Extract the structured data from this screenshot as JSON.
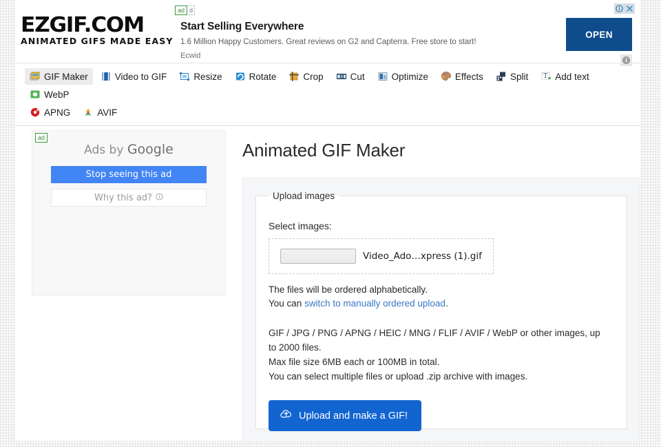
{
  "site": {
    "logo_main": "EZGIF.COM",
    "logo_sub": "ANIMATED GIFS MADE EASY"
  },
  "top_ad": {
    "badge": "ad",
    "badge_ghost": "d",
    "headline": "Start Selling Everywhere",
    "description": "1.6 Million Happy Customers. Great reviews on G2 and Capterra. Free store to start!",
    "source": "Ecwid",
    "cta_label": "OPEN",
    "info_icon": "info-icon",
    "close_icon": "close-icon",
    "corner_info_icon": "info-icon"
  },
  "nav": {
    "items": [
      {
        "label": "GIF Maker",
        "icon": "gif-maker-icon",
        "active": true
      },
      {
        "label": "Video to GIF",
        "icon": "video-icon",
        "active": false
      },
      {
        "label": "Resize",
        "icon": "resize-icon",
        "active": false
      },
      {
        "label": "Rotate",
        "icon": "rotate-icon",
        "active": false
      },
      {
        "label": "Crop",
        "icon": "crop-icon",
        "active": false
      },
      {
        "label": "Cut",
        "icon": "cut-icon",
        "active": false
      },
      {
        "label": "Optimize",
        "icon": "optimize-icon",
        "active": false
      },
      {
        "label": "Effects",
        "icon": "effects-icon",
        "active": false
      },
      {
        "label": "Split",
        "icon": "split-icon",
        "active": false
      },
      {
        "label": "Add text",
        "icon": "add-text-icon",
        "active": false
      },
      {
        "label": "WebP",
        "icon": "webp-icon",
        "active": false
      },
      {
        "label": "APNG",
        "icon": "apng-icon",
        "active": false
      },
      {
        "label": "AVIF",
        "icon": "avif-icon",
        "active": false
      }
    ]
  },
  "side_ad": {
    "badge": "ad",
    "title_prefix": "Ads by ",
    "title_brand": "Google",
    "stop_label": "Stop seeing this ad",
    "why_label": "Why this ad?",
    "why_icon": "info-icon"
  },
  "main": {
    "title": "Animated GIF Maker",
    "fieldset_legend": "Upload images",
    "select_label": "Select images:",
    "file_button_label": "",
    "file_name": "Video_Ado…xpress (1).gif",
    "order_note_line1": "The files will be ordered alphabetically.",
    "order_note_prefix": "You can ",
    "order_note_link": "switch to manually ordered upload",
    "order_note_suffix": ".",
    "formats_note": "GIF / JPG / PNG / APNG / HEIC / MNG / FLIF / AVIF / WebP or other images, up to 2000 files.",
    "size_note": "Max file size 6MB each or 100MB in total.",
    "zip_note": "You can select multiple files or upload .zip archive with images.",
    "upload_button_label": "Upload and make a GIF!",
    "upload_button_icon": "cloud-upload-icon"
  },
  "colors": {
    "accent_blue": "#1265d0",
    "ad_blue": "#0f4c8c",
    "google_blue": "#4285f4",
    "link_blue": "#3b78c3"
  }
}
